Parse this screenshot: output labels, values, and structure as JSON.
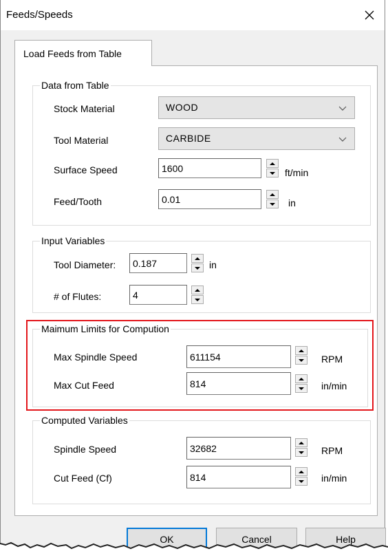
{
  "window": {
    "title": "Feeds/Speeds",
    "close_icon": "close-icon"
  },
  "tab": {
    "label": "Load Feeds from Table"
  },
  "data_from_table": {
    "legend": "Data from Table",
    "stock_material": {
      "label": "Stock Material",
      "value": "WOOD"
    },
    "tool_material": {
      "label": "Tool Material",
      "value": "CARBIDE"
    },
    "surface_speed": {
      "label": "Surface Speed",
      "value": "1600",
      "unit": "ft/min"
    },
    "feed_tooth": {
      "label": "Feed/Tooth",
      "value": "0.01",
      "unit": "in"
    }
  },
  "input_variables": {
    "legend": "Input Variables",
    "tool_diameter": {
      "label": "Tool Diameter:",
      "value": "0.187",
      "unit": "in"
    },
    "flutes": {
      "label": "# of Flutes:",
      "value": "4"
    }
  },
  "maximum_limits": {
    "legend": "Maimum Limits for Compution",
    "max_spindle_speed": {
      "label": "Max Spindle Speed",
      "value": "611154",
      "unit": "RPM"
    },
    "max_cut_feed": {
      "label": "Max Cut Feed",
      "value": "814",
      "unit": "in/min"
    }
  },
  "computed_variables": {
    "legend": "Computed Variables",
    "spindle_speed": {
      "label": "Spindle Speed",
      "value": "32682",
      "unit": "RPM"
    },
    "cut_feed": {
      "label": "Cut Feed (Cf)",
      "value": "814",
      "unit": "in/min"
    }
  },
  "buttons": {
    "ok": "OK",
    "cancel": "Cancel",
    "help": "Help"
  },
  "colors": {
    "highlight": "#e3151a",
    "default_button_border": "#0078d7"
  }
}
